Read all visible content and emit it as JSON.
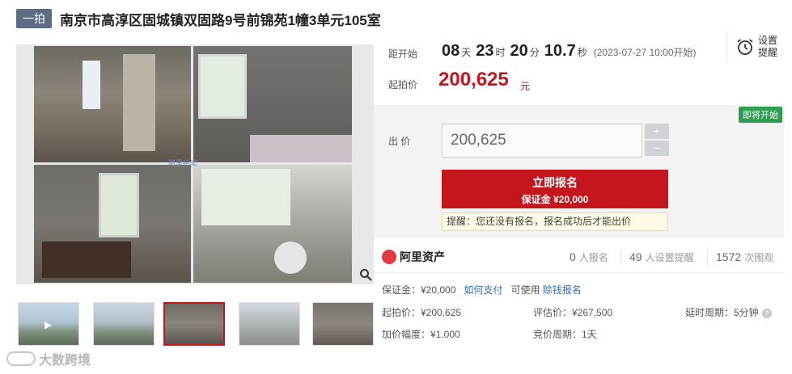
{
  "header": {
    "tag": "一拍",
    "title": "南京市高淳区固城镇双固路9号前锦苑1幢3单元105室"
  },
  "gallery": {
    "watermark": "阿里拍卖",
    "zoom_icon": "search-icon",
    "play_icon": "play-icon"
  },
  "auction": {
    "countdown_label": "距开始",
    "countdown": {
      "days": "08",
      "days_unit": "天",
      "hours": "23",
      "hours_unit": "时",
      "minutes": "20",
      "minutes_unit": "分",
      "seconds": "10.7",
      "seconds_unit": "秒",
      "start": "(2023-07-27 10:00开始)"
    },
    "start_price_label": "起拍价",
    "start_price": "200,625",
    "price_unit": "元",
    "remind": {
      "icon": "alarm-clock-icon",
      "line1": "设置",
      "line2": "提醒"
    }
  },
  "bid": {
    "status_badge": "即将开始",
    "label": "出  价",
    "value": "200,625",
    "plus": "+",
    "minus": "−",
    "button_line1": "立即报名",
    "button_line2": "保证金 ¥20,000",
    "tip": "提醒：您还没有报名，报名成功后才能出价"
  },
  "stats": {
    "brand": "阿里资产",
    "signups": "0",
    "signups_label": "人报名",
    "reminders": "49",
    "reminders_label": "人设置提醒",
    "views": "1572",
    "views_label": "次围观"
  },
  "details": {
    "deposit": "保证金：¥20,000",
    "how_to_pay": "如何支付",
    "usable": "可使用",
    "loan_signup": "赊钱报名",
    "start_price": "起拍价：¥200,625",
    "appraisal": "评估价：¥267,500",
    "delay": "延时周期：5分钟",
    "increment": "加价幅度：¥1,000",
    "cycle": "竞价周期：1天"
  },
  "brand_watermark": "大数跨境"
}
